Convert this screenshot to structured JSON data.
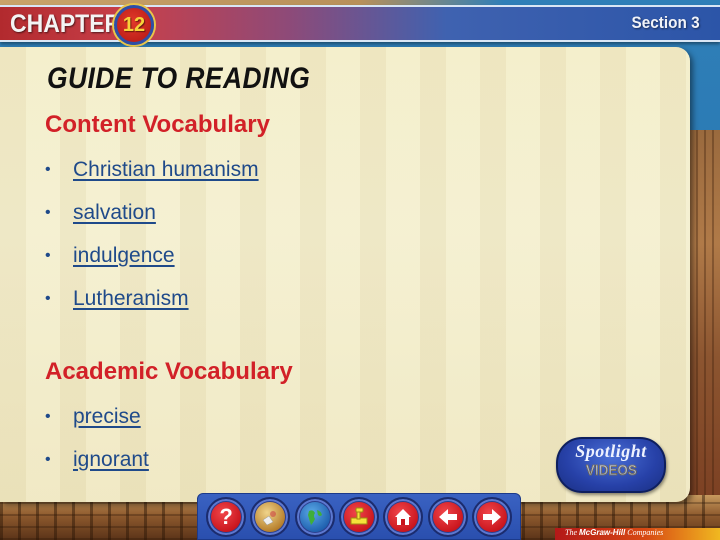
{
  "header": {
    "chapter_label": "CHAPTER",
    "chapter_number": "12",
    "section_label": "Section 3"
  },
  "panel": {
    "title": "GUIDE TO READING",
    "content_vocabulary": {
      "heading": "Content Vocabulary",
      "items": [
        "Christian humanism",
        "salvation",
        "indulgence",
        "Lutheranism"
      ]
    },
    "academic_vocabulary": {
      "heading": "Academic Vocabulary",
      "items": [
        "precise",
        "ignorant"
      ]
    }
  },
  "spotlight": {
    "line1": "Spotlight",
    "line2": "VIDEOS"
  },
  "nav": {
    "help_glyph": "?",
    "buttons": [
      {
        "name": "help",
        "icon": "question-mark-icon"
      },
      {
        "name": "maps",
        "icon": "globe-map-icon"
      },
      {
        "name": "world",
        "icon": "earth-icon"
      },
      {
        "name": "game",
        "icon": "joystick-icon"
      },
      {
        "name": "home",
        "icon": "house-icon"
      },
      {
        "name": "back",
        "icon": "arrow-left-icon"
      },
      {
        "name": "forward",
        "icon": "arrow-right-icon"
      }
    ]
  },
  "footer": {
    "brand_prefix": "The",
    "brand_name": "McGraw-Hill",
    "brand_suffix": "Companies"
  },
  "colors": {
    "heading_red": "#d22128",
    "link_blue": "#1f4a8a",
    "panel_cream": "#f3edc8",
    "nav_blue": "#2a4fae"
  }
}
